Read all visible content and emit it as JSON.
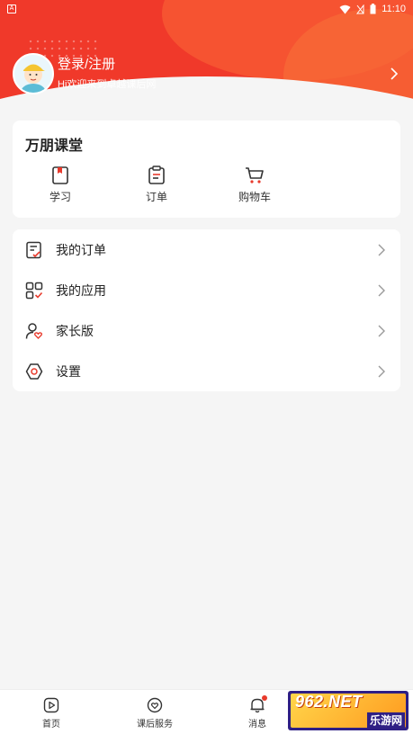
{
  "status_bar": {
    "time": "11:10",
    "app_indicator": "A"
  },
  "profile": {
    "login_label": "登录/注册",
    "welcome_text": "Hi欢迎来到卓越课后网"
  },
  "class_card": {
    "title": "万朋课堂",
    "actions": [
      {
        "label": "学习",
        "icon": "book-icon"
      },
      {
        "label": "订单",
        "icon": "order-icon"
      },
      {
        "label": "购物车",
        "icon": "cart-icon"
      }
    ]
  },
  "menu": {
    "items": [
      {
        "label": "我的订单",
        "icon": "order-list-icon"
      },
      {
        "label": "我的应用",
        "icon": "apps-icon"
      },
      {
        "label": "家长版",
        "icon": "parent-icon"
      },
      {
        "label": "设置",
        "icon": "settings-icon"
      }
    ]
  },
  "tabbar": {
    "items": [
      {
        "label": "首页",
        "icon": "home-play-icon"
      },
      {
        "label": "课后服务",
        "icon": "heart-chat-icon"
      },
      {
        "label": "消息",
        "icon": "bell-icon"
      }
    ]
  },
  "watermark": {
    "big": "962.NET",
    "sub": "乐游网"
  },
  "colors": {
    "accent": "#f0392a",
    "background": "#f5f5f5",
    "badge": "#e83a2c"
  }
}
